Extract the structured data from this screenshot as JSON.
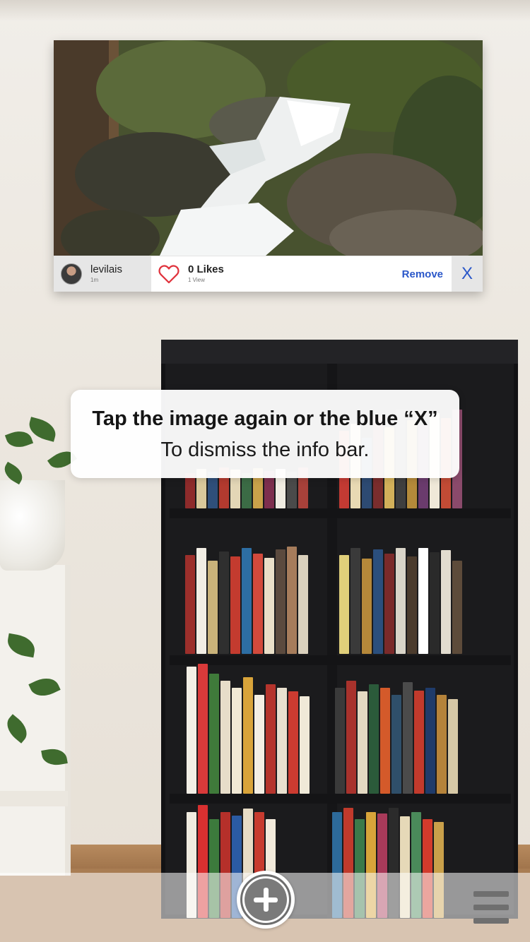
{
  "ar_card": {
    "photo_alt": "Waterfall photo",
    "user": {
      "username": "levilais",
      "time_ago": "1m"
    },
    "likes": {
      "count_label": "0 Likes",
      "views_label": "1 View"
    },
    "remove_label": "Remove",
    "close_label": "X"
  },
  "tooltip": {
    "title": "Tap the image again or the blue “X”",
    "body": "To dismiss the info bar."
  },
  "toolbar": {
    "add_icon": "plus-circle-icon",
    "menu_icon": "hamburger-menu-icon"
  },
  "colors": {
    "accent_blue": "#2a57c9",
    "heart_red": "#e0323c"
  }
}
